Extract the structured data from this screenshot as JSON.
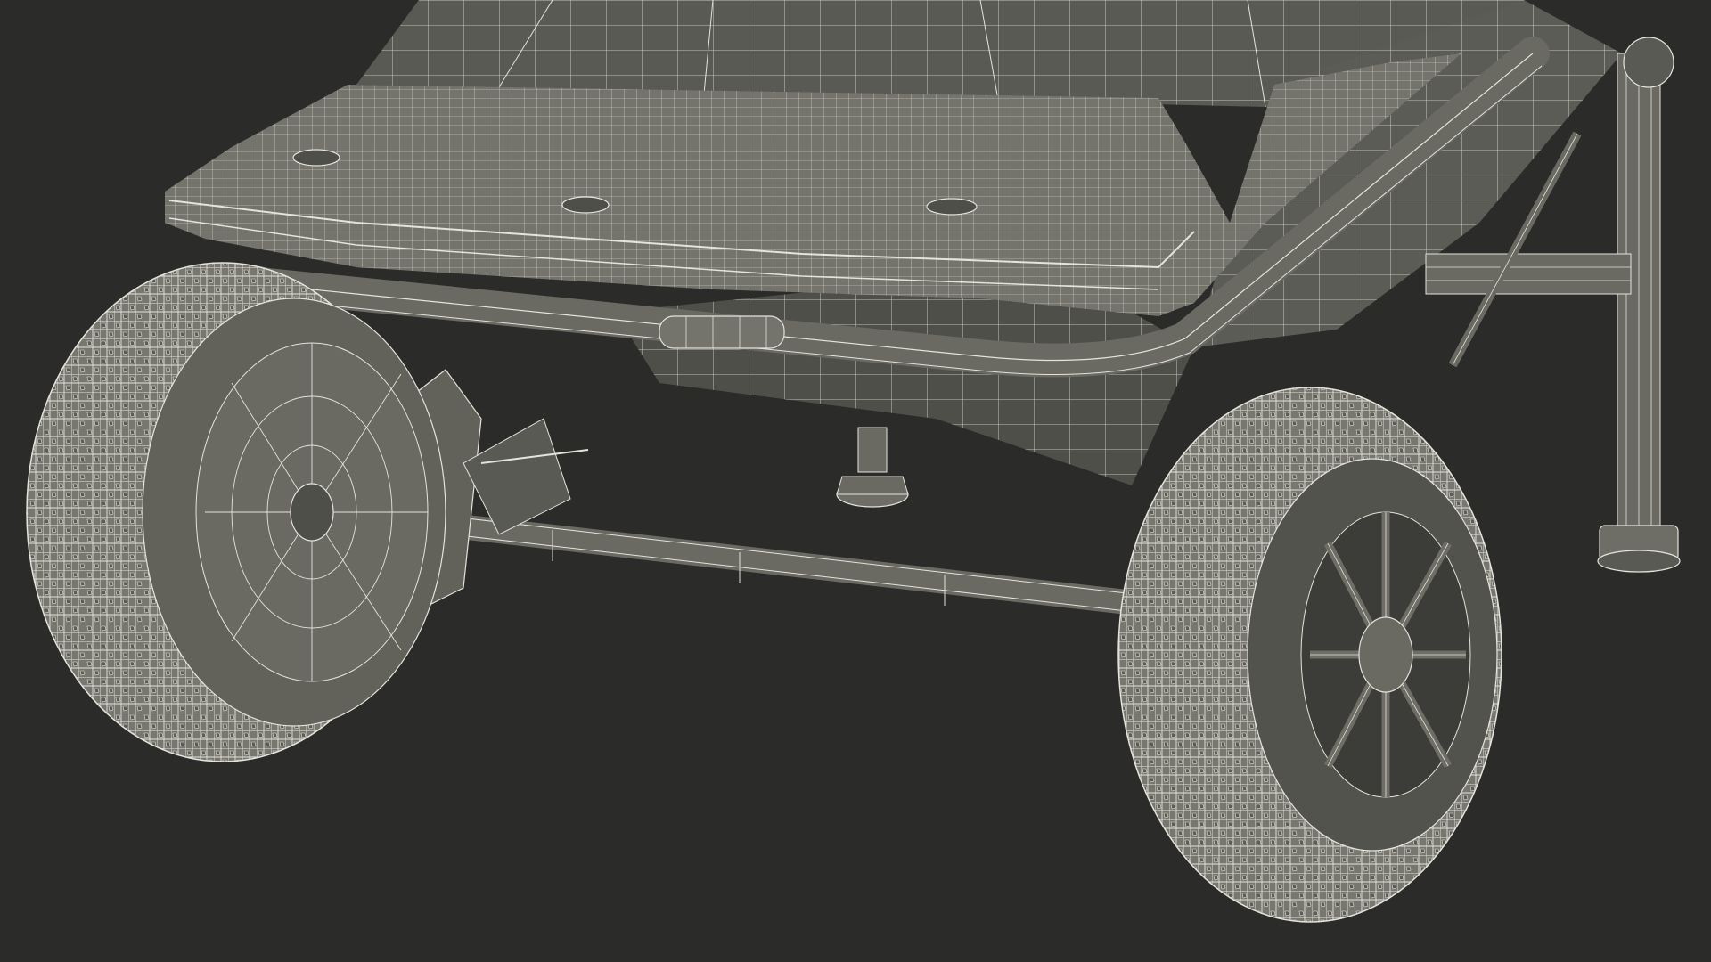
{
  "scene": {
    "subject": "wireframe-wheelbarrow-cart",
    "colors": {
      "background": "#2b2b2a",
      "surface": "#6e6e66",
      "surface_dark": "#4f4f4a",
      "surface_light": "#8a8a82",
      "tire": "#77776f",
      "wire": "#e4e4dc"
    }
  }
}
